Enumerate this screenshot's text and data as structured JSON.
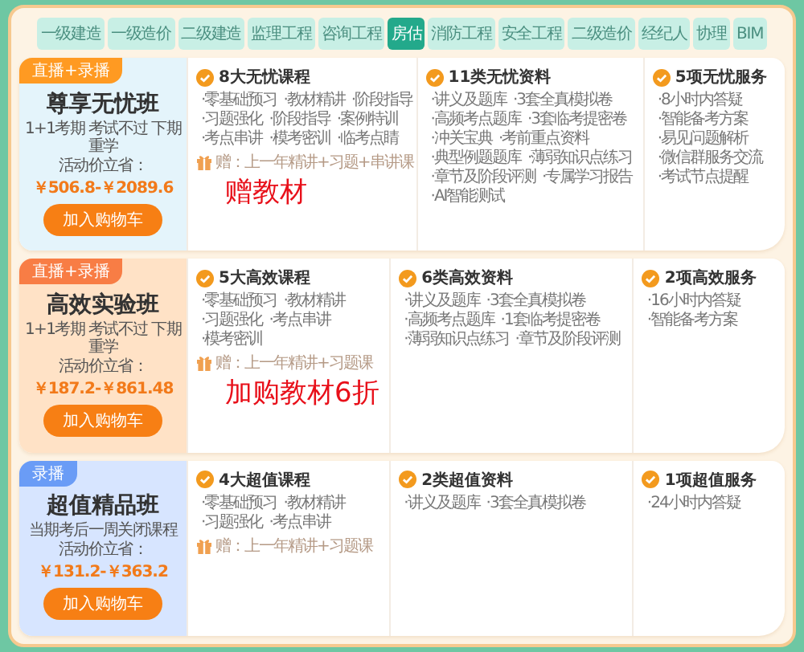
{
  "tabs": [
    {
      "label": "一级建造",
      "selected": false
    },
    {
      "label": "一级造价",
      "selected": false
    },
    {
      "label": "二级建造",
      "selected": false
    },
    {
      "label": "监理工程",
      "selected": false
    },
    {
      "label": "咨询工程",
      "selected": false
    },
    {
      "label": "房估",
      "selected": true
    },
    {
      "label": "消防工程",
      "selected": false
    },
    {
      "label": "安全工程",
      "selected": false
    },
    {
      "label": "二级造价",
      "selected": false
    },
    {
      "label": "经纪人",
      "selected": false
    },
    {
      "label": "协理",
      "selected": false
    },
    {
      "label": "BIM",
      "selected": false
    }
  ],
  "plans": [
    {
      "tag": {
        "text": "直播+录播",
        "color": "#ff9a22"
      },
      "color": "#e4f4fb",
      "name": "尊享无忧班",
      "tagline": "1+1考期 考试不过 下期重学",
      "price_label": "活动价立省：",
      "price": "￥506.8-￥2089.6",
      "button": "加入购物车",
      "columns": [
        {
          "title": "8大无忧课程",
          "items": [
            "·零基础预习",
            "·教材精讲",
            "·阶段指导",
            "·习题强化",
            "·阶段指导",
            "·案例特训",
            "·考点串讲",
            "·模考密训",
            "·临考点睛"
          ],
          "gift": "赠：上一年精讲+习题+串讲课",
          "note": "赠教材"
        },
        {
          "title": "11类无忧资料",
          "items": [
            "·讲义及题库",
            "·3套全真模拟卷",
            "·高频考点题库",
            "·3套临考提密卷",
            "·冲关宝典",
            "·考前重点资料",
            "·典型例题题库",
            "·薄弱知识点练习",
            "·章节及阶段评测",
            "·专属学习报告",
            "·AI智能测试"
          ]
        },
        {
          "title": "5项无忧服务",
          "items": [
            "·8小时内答疑",
            "·智能备考方案",
            "·易见问题解析",
            "·微信群服务交流",
            "·考试节点提醒"
          ]
        }
      ]
    },
    {
      "tag": {
        "text": "直播+录播",
        "color": "#f87d45"
      },
      "color": "#ffe2c6",
      "name": "高效实验班",
      "tagline": "1+1考期 考试不过 下期重学",
      "price_label": "活动价立省：",
      "price": "￥187.2-￥861.48",
      "button": "加入购物车",
      "columns": [
        {
          "title": "5大高效课程",
          "items": [
            "·零基础预习",
            "·教材精讲",
            "·习题强化",
            "·考点串讲",
            "·模考密训"
          ],
          "gift": "赠：上一年精讲+习题课",
          "note": "加购教材6折"
        },
        {
          "title": "6类高效资料",
          "items": [
            "·讲义及题库",
            "·3套全真模拟卷",
            "·高频考点题库",
            "·1套临考提密卷",
            "·薄弱知识点练习",
            "·章节及阶段评测"
          ]
        },
        {
          "title": "2项高效服务",
          "items": [
            "·16小时内答疑",
            "·智能备考方案"
          ]
        }
      ]
    },
    {
      "tag": {
        "text": "录播",
        "color": "#6a9cf6"
      },
      "color": "#d7e5ff",
      "name": "超值精品班",
      "tagline": "当期考后一周关闭课程",
      "price_label": "活动价立省：",
      "price": "￥131.2-￥363.2",
      "button": "加入购物车",
      "columns": [
        {
          "title": "4大超值课程",
          "items": [
            "·零基础预习",
            "·教材精讲",
            "·习题强化",
            "·考点串讲"
          ],
          "gift": "赠：上一年精讲+习题课"
        },
        {
          "title": "2类超值资料",
          "items": [
            "·讲义及题库",
            "·3套全真模拟卷"
          ]
        },
        {
          "title": "1项超值服务",
          "items": [
            "·24小时内答疑"
          ]
        }
      ]
    }
  ]
}
